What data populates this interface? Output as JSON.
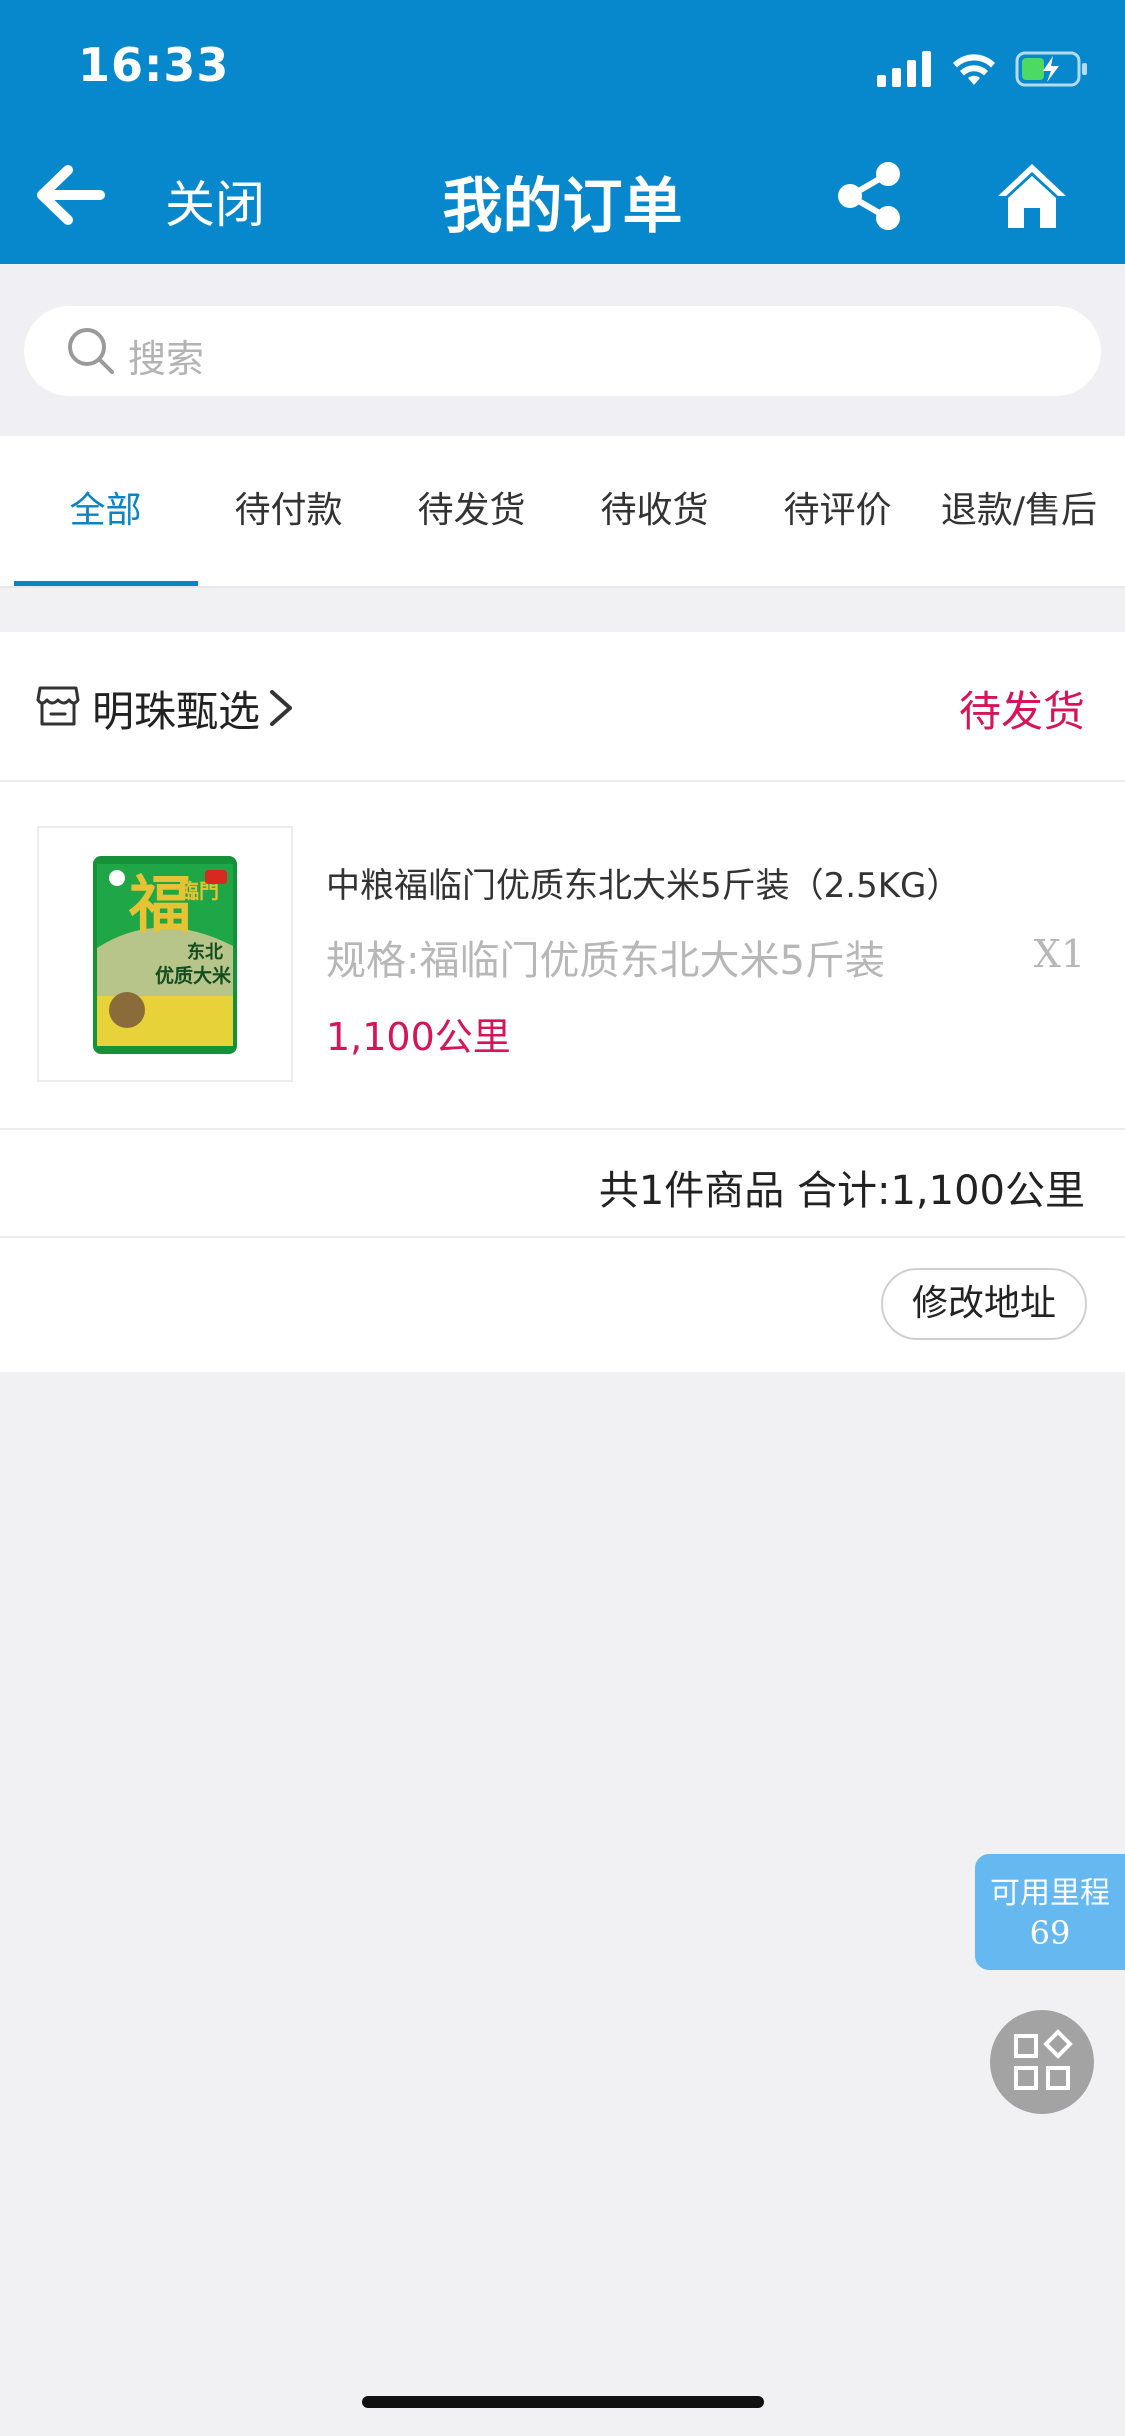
{
  "status_bar": {
    "time": "16:33"
  },
  "header": {
    "back_icon": "arrow-left-icon",
    "close_label": "关闭",
    "title": "我的订单",
    "share_icon": "share-icon",
    "home_icon": "home-icon",
    "color": "#0788cc"
  },
  "search": {
    "placeholder": "搜索"
  },
  "tabs": [
    {
      "label": "全部",
      "active": true
    },
    {
      "label": "待付款"
    },
    {
      "label": "待发货"
    },
    {
      "label": "待收货"
    },
    {
      "label": "待评价"
    },
    {
      "label": "退款/售后"
    }
  ],
  "order": {
    "store_name": "明珠甄选",
    "status": "待发货",
    "product": {
      "name": "中粮福临门优质东北大米5斤装（2.5KG）",
      "spec": "规格:福临门优质东北大米5斤装",
      "quantity": "X1",
      "price": "1,100公里",
      "package_text": {
        "logo": "福",
        "brand": "臨門",
        "line1": "东北",
        "line2": "优质大米"
      }
    },
    "summary": "共1件商品 合计:1,100公里",
    "action_label": "修改地址"
  },
  "floating": {
    "mileage_label": "可用里程",
    "mileage_value": "69"
  },
  "colors": {
    "accent": "#0b84c4",
    "status": "#d5145a",
    "mileage": "#66b9f0"
  }
}
